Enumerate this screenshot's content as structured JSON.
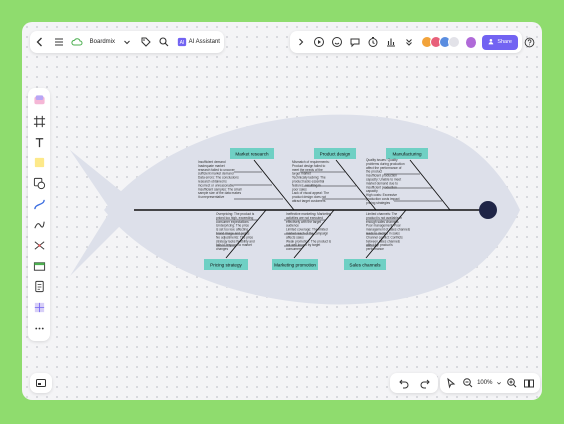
{
  "toolbar": {
    "app_name": "Boardmix",
    "ai_label": "AI Assistant",
    "share_label": "Share",
    "ai_badge_text": "AI"
  },
  "zoom": {
    "level": "100%"
  },
  "colors": {
    "background": "#8fdc6e",
    "fish_body": "#dde0ea",
    "category_box": "#6fd0c4",
    "accent": "#7263f2",
    "head_circle": "#1f2547"
  },
  "diagram": {
    "top_categories": [
      "Market research",
      "Product design",
      "Manufacturing"
    ],
    "bottom_categories": [
      "Pricing strategy",
      "Marketing promotion",
      "Sales channels"
    ],
    "notes": {
      "market_research": [
        "Insufficient demand",
        "Inadequate market",
        "research failed to uncover",
        "sufficient market demand",
        "Data errors: The conclusions",
        "research obtained is",
        "incorrect or unreasonable",
        "Insufficient samples: The small",
        "sample size of the data makes",
        "it unrepresentative"
      ],
      "product_design": [
        "Mismatch of requirements:",
        "Product design failed to",
        "meet the needs of the",
        "target market",
        "Technically lacking: The",
        "product lacks essential",
        "features, resulting in",
        "poor sales",
        "Lack of visual appeal: The",
        "product design does not",
        "attract target customers"
      ],
      "manufacturing": [
        "Quality issues: Quality",
        "problems during production",
        "affect the performance of",
        "the product",
        "Insufficient production",
        "capacity: Unable to meet",
        "market demand due to",
        "insufficient production",
        "capacity",
        "High costs: Excessive",
        "production costs impact",
        "pricing strategies"
      ],
      "pricing_strategy": [
        "Overpricing: The product is",
        "priced too high, exceeding",
        "consumer expectations",
        "Underpricing: The price",
        "is set too low, affecting",
        "brand image and profits",
        "No adjustments: The price",
        "strategy lacks flexibility and",
        "fails to respond to market",
        "changes"
      ],
      "marketing_promotion": [
        "Ineffective marketing: Marketing",
        "activities are not executed",
        "effectively with the target",
        "audience",
        "Limited coverage: The limited",
        "market reach of the campaign",
        "affects sales",
        "Weak promotion: The product is",
        "not well known by target",
        "consumers"
      ],
      "sales_channels": [
        "Limited channels: The",
        "product is not available in",
        "enough sales channels",
        "Poor management: Poor",
        "management of sales channels",
        "leads to decline in sales",
        "Channel conflict: Conflicts",
        "between sales channels",
        "affect the product's",
        "performance"
      ]
    }
  }
}
